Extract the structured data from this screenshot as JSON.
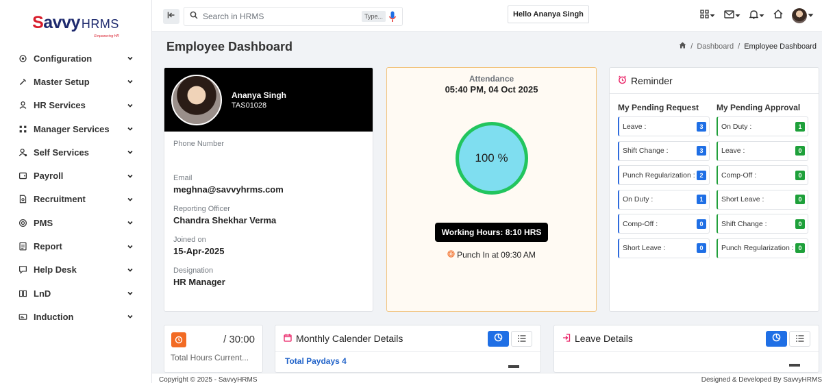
{
  "brand": {
    "name_first": "S",
    "name_rest": "avvy",
    "suffix": "HRMS",
    "tagline": "Empowering HR"
  },
  "sidebar": {
    "items": [
      {
        "label": "Configuration",
        "icon": "gear-icon"
      },
      {
        "label": "Master Setup",
        "icon": "tools-icon"
      },
      {
        "label": "HR Services",
        "icon": "user-icon"
      },
      {
        "label": "Manager Services",
        "icon": "manager-icon"
      },
      {
        "label": "Self Services",
        "icon": "user-gear-icon"
      },
      {
        "label": "Payroll",
        "icon": "wallet-icon"
      },
      {
        "label": "Recruitment",
        "icon": "file-search-icon"
      },
      {
        "label": "PMS",
        "icon": "target-icon"
      },
      {
        "label": "Report",
        "icon": "report-icon"
      },
      {
        "label": "Help Desk",
        "icon": "chat-icon"
      },
      {
        "label": "LnD",
        "icon": "book-icon"
      },
      {
        "label": "Induction",
        "icon": "id-card-icon"
      }
    ]
  },
  "topbar": {
    "search_placeholder": "Search in HRMS",
    "type_badge": "Type...",
    "greeting": "Hello Ananya Singh"
  },
  "page": {
    "title": "Employee Dashboard",
    "breadcrumb": [
      "Dashboard",
      "Employee Dashboard"
    ]
  },
  "profile": {
    "name": "Ananya Singh",
    "code": "TAS01028",
    "fields": [
      {
        "label": "Phone Number",
        "value": ""
      },
      {
        "label": "Email",
        "value": "meghna@savvyhrms.com"
      },
      {
        "label": "Reporting Officer",
        "value": "Chandra Shekhar Verma"
      },
      {
        "label": "Joined on",
        "value": "15-Apr-2025"
      },
      {
        "label": "Designation",
        "value": "HR Manager"
      }
    ]
  },
  "attendance": {
    "label": "Attendance",
    "datetime": "05:40 PM, 04 Oct 2025",
    "percent": "100 %",
    "working_hours": "Working Hours: 8:10 HRS",
    "punch_in": "Punch In at 09:30 AM"
  },
  "reminder": {
    "title": "Reminder",
    "pending_request": {
      "title": "My Pending Request",
      "items": [
        {
          "label": "Leave :",
          "count": "3"
        },
        {
          "label": "Shift Change :",
          "count": "3"
        },
        {
          "label": "Punch Regularization :",
          "count": "2"
        },
        {
          "label": "On Duty :",
          "count": "1"
        },
        {
          "label": "Comp-Off :",
          "count": "0"
        },
        {
          "label": "Short Leave :",
          "count": "0"
        }
      ]
    },
    "pending_approval": {
      "title": "My Pending Approval",
      "items": [
        {
          "label": "On Duty :",
          "count": "1"
        },
        {
          "label": "Leave :",
          "count": "0"
        },
        {
          "label": "Comp-Off :",
          "count": "0"
        },
        {
          "label": "Short Leave :",
          "count": "0"
        },
        {
          "label": "Shift Change :",
          "count": "0"
        },
        {
          "label": "Punch Regularization :",
          "count": "0"
        }
      ]
    }
  },
  "hours": {
    "value": "/ 30:00",
    "label": "Total Hours Current..."
  },
  "calendar": {
    "title": "Monthly Calender Details",
    "paydays": "Total Paydays 4"
  },
  "leave": {
    "title": "Leave Details"
  },
  "footer": {
    "left": "Copyright © 2025 - SavvyHRMS",
    "right": "Designed & Developed By SavvyHRMS"
  },
  "colors": {
    "accent": "#1f6fe5",
    "success": "#22c55e",
    "brand_red": "#d81e2c",
    "brand_navy": "#1e2a6e",
    "orange": "#f26b24"
  }
}
